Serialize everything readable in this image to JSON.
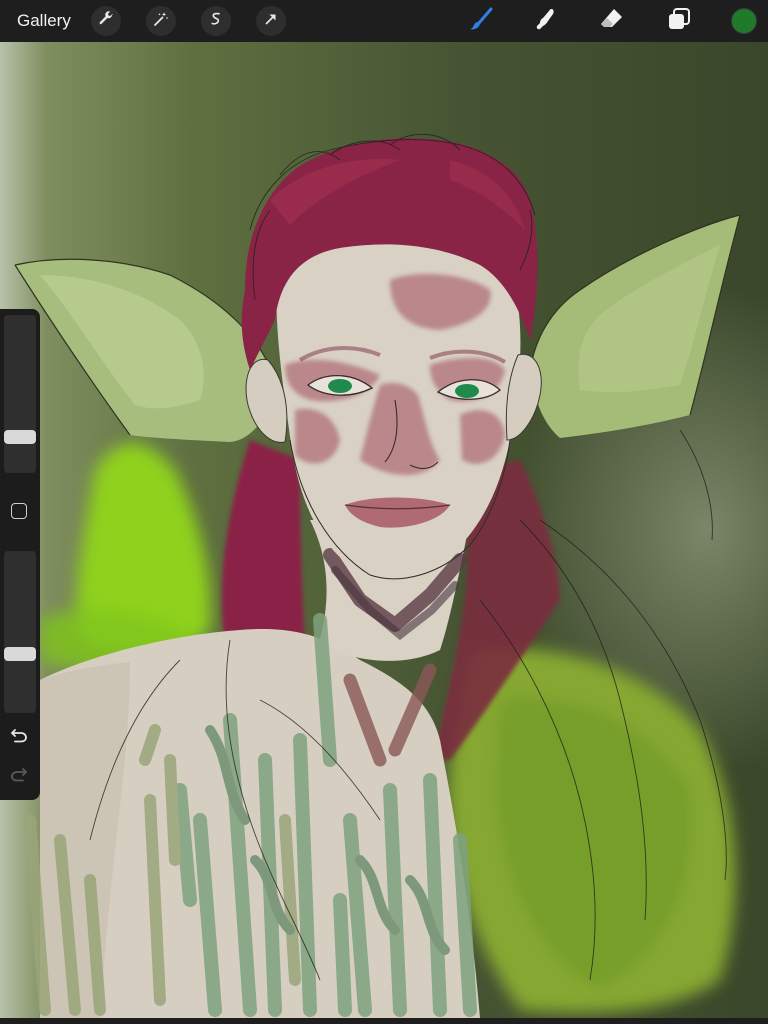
{
  "toolbar": {
    "gallery_label": "Gallery",
    "actions_icon": "wrench-icon",
    "adjustments_icon": "magic-wand-icon",
    "selection_icon": "selection-s-icon",
    "transform_icon": "arrow-cursor-icon",
    "brush_icon": "brush-icon",
    "smudge_icon": "smudge-finger-icon",
    "eraser_icon": "eraser-icon",
    "layers_icon": "layers-icon",
    "active_tool": "brush",
    "active_tool_color": "#2f7fe6",
    "current_color": "#1f7a2c"
  },
  "sidebar": {
    "brush_size": 0.2,
    "opacity": 0.35,
    "modify_icon": "square-modify-icon",
    "undo_icon": "undo-icon",
    "redo_icon": "redo-icon"
  },
  "canvas": {
    "palette": {
      "background": "#4b5a35",
      "hair": "#8a2446",
      "skin": "#d8d1c4",
      "blush": "#b07077",
      "ears": "#a7bd7e",
      "glow": "#8fd11e",
      "shirt_green": "#7fa27f",
      "eyes": "#1f8a4c"
    }
  }
}
